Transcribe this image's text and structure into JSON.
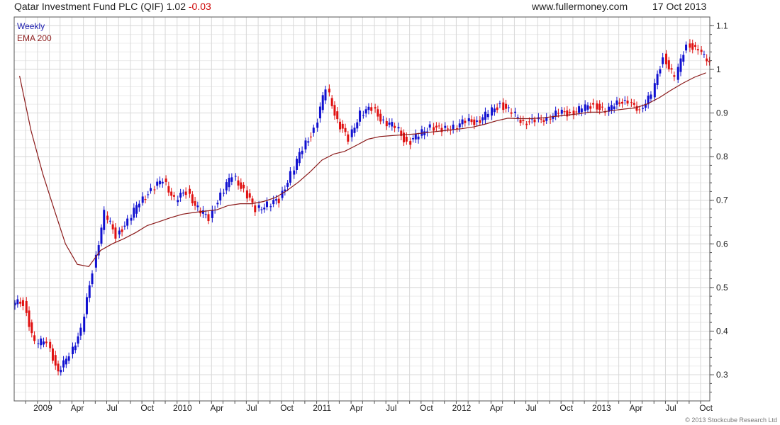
{
  "header": {
    "title": "Qatar Investment Fund PLC (QIF)",
    "last": "1.02",
    "change": "-0.03",
    "site": "www.fullermoney.com",
    "date": "17 Oct 2013"
  },
  "legend": {
    "period": "Weekly",
    "ema_label": "EMA 200"
  },
  "copyright": "© 2013 Stockcube Research Ltd",
  "colors": {
    "up": "#1010d0",
    "down": "#e01010",
    "ema": "#8b1a1a",
    "grid": "#d8d8d8",
    "axis": "#555555"
  },
  "chart_data": {
    "type": "line",
    "title": "Qatar Investment Fund PLC (QIF)",
    "x_axis": {
      "range": [
        "2008-11-01",
        "2013-10-25"
      ],
      "ticks": [
        "2009",
        "Apr",
        "Jul",
        "Oct",
        "2010",
        "Apr",
        "Jul",
        "Oct",
        "2011",
        "Apr",
        "Jul",
        "Oct",
        "2012",
        "Apr",
        "Jul",
        "Oct",
        "2013",
        "Apr",
        "Jul",
        "Oct"
      ]
    },
    "y_axis": {
      "range": [
        0.24,
        1.12
      ],
      "ticks": [
        "0.3",
        "0.4",
        "0.5",
        "0.6",
        "0.7",
        "0.8",
        "0.9",
        "1",
        "1.1"
      ],
      "side": "right"
    },
    "grid": true,
    "legend_position": "top-left",
    "series": [
      {
        "name": "Weekly",
        "style": "price bars",
        "points": [
          [
            "2008-11",
            0.465
          ],
          [
            "2008-12",
            0.37
          ],
          [
            "2009-01",
            0.38
          ],
          [
            "2009-02",
            0.3
          ],
          [
            "2009-03",
            0.35
          ],
          [
            "2009-04",
            0.4
          ],
          [
            "2009-05",
            0.54
          ],
          [
            "2009-06",
            0.67
          ],
          [
            "2009-07",
            0.62
          ],
          [
            "2009-08",
            0.65
          ],
          [
            "2009-09",
            0.7
          ],
          [
            "2009-10",
            0.72
          ],
          [
            "2009-11",
            0.75
          ],
          [
            "2009-12",
            0.7
          ],
          [
            "2010-01",
            0.72
          ],
          [
            "2010-02",
            0.68
          ],
          [
            "2010-03",
            0.66
          ],
          [
            "2010-04",
            0.71
          ],
          [
            "2010-05",
            0.76
          ],
          [
            "2010-06",
            0.72
          ],
          [
            "2010-07",
            0.68
          ],
          [
            "2010-08",
            0.69
          ],
          [
            "2010-09",
            0.7
          ],
          [
            "2010-10",
            0.76
          ],
          [
            "2010-11",
            0.82
          ],
          [
            "2010-12",
            0.86
          ],
          [
            "2011-01",
            0.96
          ],
          [
            "2011-02",
            0.88
          ],
          [
            "2011-03",
            0.84
          ],
          [
            "2011-04",
            0.9
          ],
          [
            "2011-05",
            0.91
          ],
          [
            "2011-06",
            0.88
          ],
          [
            "2011-07",
            0.87
          ],
          [
            "2011-08",
            0.83
          ],
          [
            "2011-09",
            0.85
          ],
          [
            "2011-10",
            0.87
          ],
          [
            "2011-11",
            0.86
          ],
          [
            "2011-12",
            0.87
          ],
          [
            "2012-01",
            0.88
          ],
          [
            "2012-02",
            0.88
          ],
          [
            "2012-03",
            0.9
          ],
          [
            "2012-04",
            0.92
          ],
          [
            "2012-05",
            0.9
          ],
          [
            "2012-06",
            0.88
          ],
          [
            "2012-07",
            0.88
          ],
          [
            "2012-08",
            0.89
          ],
          [
            "2012-09",
            0.9
          ],
          [
            "2012-10",
            0.9
          ],
          [
            "2012-11",
            0.91
          ],
          [
            "2012-12",
            0.92
          ],
          [
            "2013-01",
            0.9
          ],
          [
            "2013-02",
            0.93
          ],
          [
            "2013-03",
            0.92
          ],
          [
            "2013-04",
            0.91
          ],
          [
            "2013-05",
            0.94
          ],
          [
            "2013-06",
            1.03
          ],
          [
            "2013-07",
            0.98
          ],
          [
            "2013-08",
            1.06
          ],
          [
            "2013-09",
            1.04
          ],
          [
            "2013-10",
            1.02
          ]
        ]
      },
      {
        "name": "EMA 200",
        "style": "line",
        "points": [
          [
            "2008-11",
            0.985
          ],
          [
            "2008-12",
            0.86
          ],
          [
            "2009-01",
            0.76
          ],
          [
            "2009-02",
            0.675
          ],
          [
            "2009-03",
            0.6
          ],
          [
            "2009-04",
            0.553
          ],
          [
            "2009-05",
            0.548
          ],
          [
            "2009-06",
            0.585
          ],
          [
            "2009-07",
            0.6
          ],
          [
            "2009-08",
            0.612
          ],
          [
            "2009-09",
            0.626
          ],
          [
            "2009-10",
            0.642
          ],
          [
            "2009-11",
            0.651
          ],
          [
            "2009-12",
            0.66
          ],
          [
            "2010-01",
            0.668
          ],
          [
            "2010-02",
            0.672
          ],
          [
            "2010-03",
            0.675
          ],
          [
            "2010-04",
            0.678
          ],
          [
            "2010-05",
            0.688
          ],
          [
            "2010-06",
            0.692
          ],
          [
            "2010-07",
            0.692
          ],
          [
            "2010-08",
            0.697
          ],
          [
            "2010-09",
            0.706
          ],
          [
            "2010-10",
            0.722
          ],
          [
            "2010-11",
            0.742
          ],
          [
            "2010-12",
            0.765
          ],
          [
            "2011-01",
            0.792
          ],
          [
            "2011-02",
            0.806
          ],
          [
            "2011-03",
            0.812
          ],
          [
            "2011-04",
            0.826
          ],
          [
            "2011-05",
            0.84
          ],
          [
            "2011-06",
            0.846
          ],
          [
            "2011-07",
            0.848
          ],
          [
            "2011-08",
            0.85
          ],
          [
            "2011-09",
            0.852
          ],
          [
            "2011-10",
            0.855
          ],
          [
            "2011-11",
            0.858
          ],
          [
            "2011-12",
            0.861
          ],
          [
            "2012-01",
            0.864
          ],
          [
            "2012-02",
            0.868
          ],
          [
            "2012-03",
            0.874
          ],
          [
            "2012-04",
            0.882
          ],
          [
            "2012-05",
            0.888
          ],
          [
            "2012-06",
            0.887
          ],
          [
            "2012-07",
            0.887
          ],
          [
            "2012-08",
            0.889
          ],
          [
            "2012-09",
            0.892
          ],
          [
            "2012-10",
            0.895
          ],
          [
            "2012-11",
            0.898
          ],
          [
            "2012-12",
            0.902
          ],
          [
            "2013-01",
            0.902
          ],
          [
            "2013-02",
            0.906
          ],
          [
            "2013-03",
            0.909
          ],
          [
            "2013-04",
            0.912
          ],
          [
            "2013-05",
            0.921
          ],
          [
            "2013-06",
            0.935
          ],
          [
            "2013-07",
            0.952
          ],
          [
            "2013-08",
            0.968
          ],
          [
            "2013-09",
            0.982
          ],
          [
            "2013-10",
            0.992
          ]
        ]
      }
    ]
  }
}
